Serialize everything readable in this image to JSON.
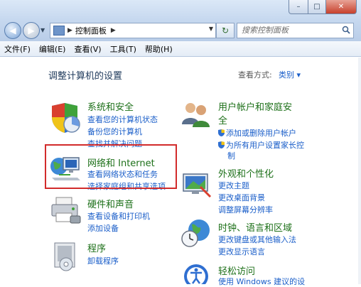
{
  "window": {
    "title_buttons": {
      "minimize": "–",
      "maximize": "□",
      "close": "✕"
    }
  },
  "nav": {
    "back_icon": "back-arrow-icon",
    "forward_icon": "forward-arrow-icon",
    "breadcrumb": "控制面板",
    "search_placeholder": "搜索控制面板"
  },
  "menu": [
    "文件(F)",
    "编辑(E)",
    "查看(V)",
    "工具(T)",
    "帮助(H)"
  ],
  "content": {
    "heading": "调整计算机的设置",
    "view_by_label": "查看方式:",
    "view_by_value": "类别 ▾"
  },
  "categories": {
    "system": {
      "title": "系统和安全",
      "links": [
        "查看您的计算机状态",
        "备份您的计算机",
        "查找并解决问题"
      ]
    },
    "network": {
      "title": "网络和 Internet",
      "links": [
        "查看网络状态和任务",
        "选择家庭组和共享选项"
      ]
    },
    "hardware": {
      "title": "硬件和声音",
      "links": [
        "查看设备和打印机",
        "添加设备"
      ]
    },
    "programs": {
      "title": "程序",
      "links": [
        "卸载程序"
      ]
    },
    "users": {
      "title_line1": "用户帐户和家庭安",
      "title_line2": "全",
      "links": [
        "添加或删除用户帐户",
        "为所有用户设置家长控",
        "制"
      ]
    },
    "appearance": {
      "title": "外观和个性化",
      "links": [
        "更改主题",
        "更改桌面背景",
        "调整屏幕分辨率"
      ]
    },
    "clock": {
      "title": "时钟、语言和区域",
      "links": [
        "更改键盘或其他输入法",
        "更改显示语言"
      ]
    },
    "access": {
      "title": "轻松访问",
      "links": [
        "使用 Windows 建议的设"
      ]
    }
  },
  "colors": {
    "category_title": "#1d7019",
    "link": "#1a5ec9",
    "highlight_border": "#d22b2b"
  }
}
